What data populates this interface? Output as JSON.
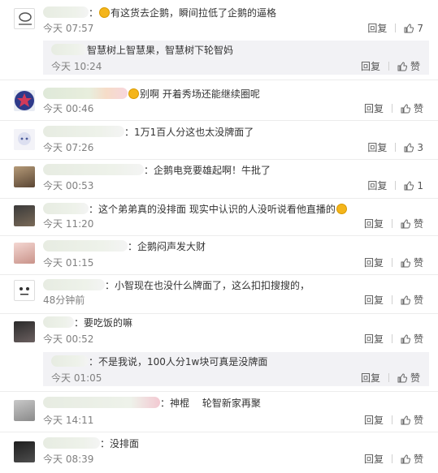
{
  "common": {
    "reply_label": "回复",
    "like_label": "赞"
  },
  "comments": [
    {
      "text_before": "：",
      "text_after": "有这货去企鹅，瞬间拉低了企鹅的逼格",
      "time": "今天 07:57",
      "likes": "7"
    },
    {
      "text_before": "",
      "text_after": "智慧树上智慧果，智慧树下轮智妈",
      "time": "今天 10:24",
      "likes": "赞",
      "is_reply": true
    },
    {
      "text_before": "",
      "text_after": "别啊 开着秀场还能继续圈呢",
      "time": "今天 00:46",
      "likes": "赞"
    },
    {
      "text_before": "：",
      "text_after": "1万1百人分这也太没牌面了",
      "time": "今天 07:26",
      "likes": "3"
    },
    {
      "text_before": "：",
      "text_after": "企鹅电竞要雄起啊！牛批了",
      "time": "今天 00:53",
      "likes": "1"
    },
    {
      "text_before": "：",
      "text_after": "这个弟弟真的没排面 现实中认识的人没听说看他直播的",
      "time": "今天 11:20",
      "likes": "赞"
    },
    {
      "text_before": "：",
      "text_after": "企鹅闷声发大财",
      "time": "今天 01:15",
      "likes": "赞"
    },
    {
      "text_before": "：",
      "text_after": "小智现在也没什么牌面了，这么扣扣搜搜的，",
      "time": "48分钟前",
      "likes": "赞"
    },
    {
      "text_before": "：",
      "text_after": "要吃饭的嘛",
      "time": "今天 00:52",
      "likes": "赞"
    },
    {
      "text_before": "：",
      "text_after": "不是我说，100人分1w块可真是没牌面",
      "time": "今天 01:05",
      "likes": "赞",
      "is_reply": true
    },
    {
      "text_before": "：",
      "text_after": "神棍　 轮智新家再聚",
      "time": "今天 14:11",
      "likes": "赞"
    },
    {
      "text_before": "：",
      "text_after": "没排面",
      "time": "今天 08:39",
      "likes": "赞"
    }
  ],
  "colors": {
    "background": "#ffffff",
    "reply_bg": "#f2f2f5",
    "meta": "#808080",
    "separator": "#ececec"
  }
}
